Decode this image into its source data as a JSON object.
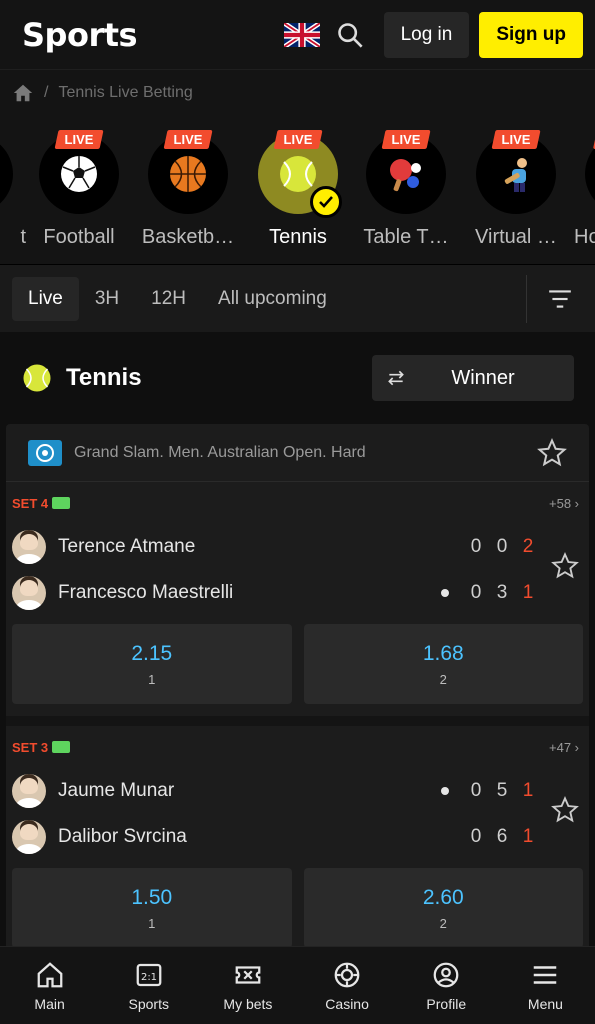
{
  "header": {
    "logo": "Sports",
    "login_label": "Log in",
    "signup_label": "Sign up",
    "flag_icon": "uk-flag-icon",
    "search_icon": "search-icon"
  },
  "breadcrumb": {
    "separator": "/",
    "current": "Tennis Live Betting"
  },
  "sports": [
    {
      "label": "t",
      "live": false,
      "icon": "partial-icon"
    },
    {
      "label": "Football",
      "live": true,
      "badge": "LIVE",
      "icon": "football-icon"
    },
    {
      "label": "Basketb…",
      "live": true,
      "badge": "LIVE",
      "icon": "basketball-icon"
    },
    {
      "label": "Tennis",
      "live": true,
      "badge": "LIVE",
      "icon": "tennis-ball-icon",
      "active": true
    },
    {
      "label": "Table T…",
      "live": true,
      "badge": "LIVE",
      "icon": "table-tennis-icon"
    },
    {
      "label": "Virtual …",
      "live": true,
      "badge": "LIVE",
      "icon": "virtual-icon"
    },
    {
      "label": "Ho",
      "live": true,
      "badge": "",
      "icon": "partial-icon"
    }
  ],
  "filters": {
    "items": [
      "Live",
      "3H",
      "12H",
      "All upcoming"
    ],
    "active": "Live"
  },
  "section": {
    "title": "Tennis",
    "market_label": "Winner"
  },
  "tournament": {
    "name": "Grand Slam. Men. Australian Open. Hard"
  },
  "matches": [
    {
      "set": "SET 4",
      "more": "+58 ›",
      "players": [
        {
          "name": "Terence Atmane",
          "serving": false,
          "scores": [
            "0",
            "0",
            "2"
          ]
        },
        {
          "name": "Francesco Maestrelli",
          "serving": true,
          "scores": [
            "0",
            "3",
            "1"
          ]
        }
      ],
      "odds": [
        {
          "value": "2.15",
          "key": "1"
        },
        {
          "value": "1.68",
          "key": "2"
        }
      ]
    },
    {
      "set": "SET 3",
      "more": "+47 ›",
      "players": [
        {
          "name": "Jaume Munar",
          "serving": true,
          "scores": [
            "0",
            "5",
            "1"
          ]
        },
        {
          "name": "Dalibor Svrcina",
          "serving": false,
          "scores": [
            "0",
            "6",
            "1"
          ]
        }
      ],
      "odds": [
        {
          "value": "1.50",
          "key": "1"
        },
        {
          "value": "2.60",
          "key": "2"
        }
      ]
    }
  ],
  "bottom_nav": [
    {
      "label": "Main",
      "icon": "home-icon"
    },
    {
      "label": "Sports",
      "icon": "scoreboard-icon"
    },
    {
      "label": "My bets",
      "icon": "ticket-icon"
    },
    {
      "label": "Casino",
      "icon": "chip-icon"
    },
    {
      "label": "Profile",
      "icon": "profile-icon"
    },
    {
      "label": "Menu",
      "icon": "menu-icon"
    }
  ],
  "colors": {
    "accent_yellow": "#ffee00",
    "live_red": "#f24c2e",
    "odd_blue": "#4cc3ff"
  }
}
